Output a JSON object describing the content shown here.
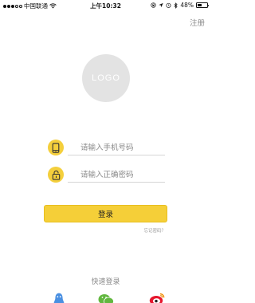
{
  "status_bar": {
    "carrier": "中国联通",
    "time": "上午10:32",
    "battery": "48%",
    "battery_level": 0.48
  },
  "header": {
    "register_label": "注册"
  },
  "logo": {
    "text": "LOGO"
  },
  "form": {
    "phone": {
      "placeholder": "请输入手机号码",
      "value": "",
      "icon": "phone-icon"
    },
    "password": {
      "placeholder": "请输入正确密码",
      "value": "",
      "icon": "lock-icon"
    },
    "login_label": "登录",
    "forgot_label": "忘记密码？"
  },
  "quick_login": {
    "title": "快速登录",
    "providers": [
      {
        "icon": "qq-icon",
        "color": "#4a90e2"
      },
      {
        "icon": "wechat-icon",
        "color": "#62b73f"
      },
      {
        "icon": "weibo-icon",
        "color": "#e6162d"
      }
    ]
  },
  "colors": {
    "accent": "#f5cf38",
    "logo_bg": "#e3e3e3",
    "muted_text": "#8a8a8a"
  }
}
